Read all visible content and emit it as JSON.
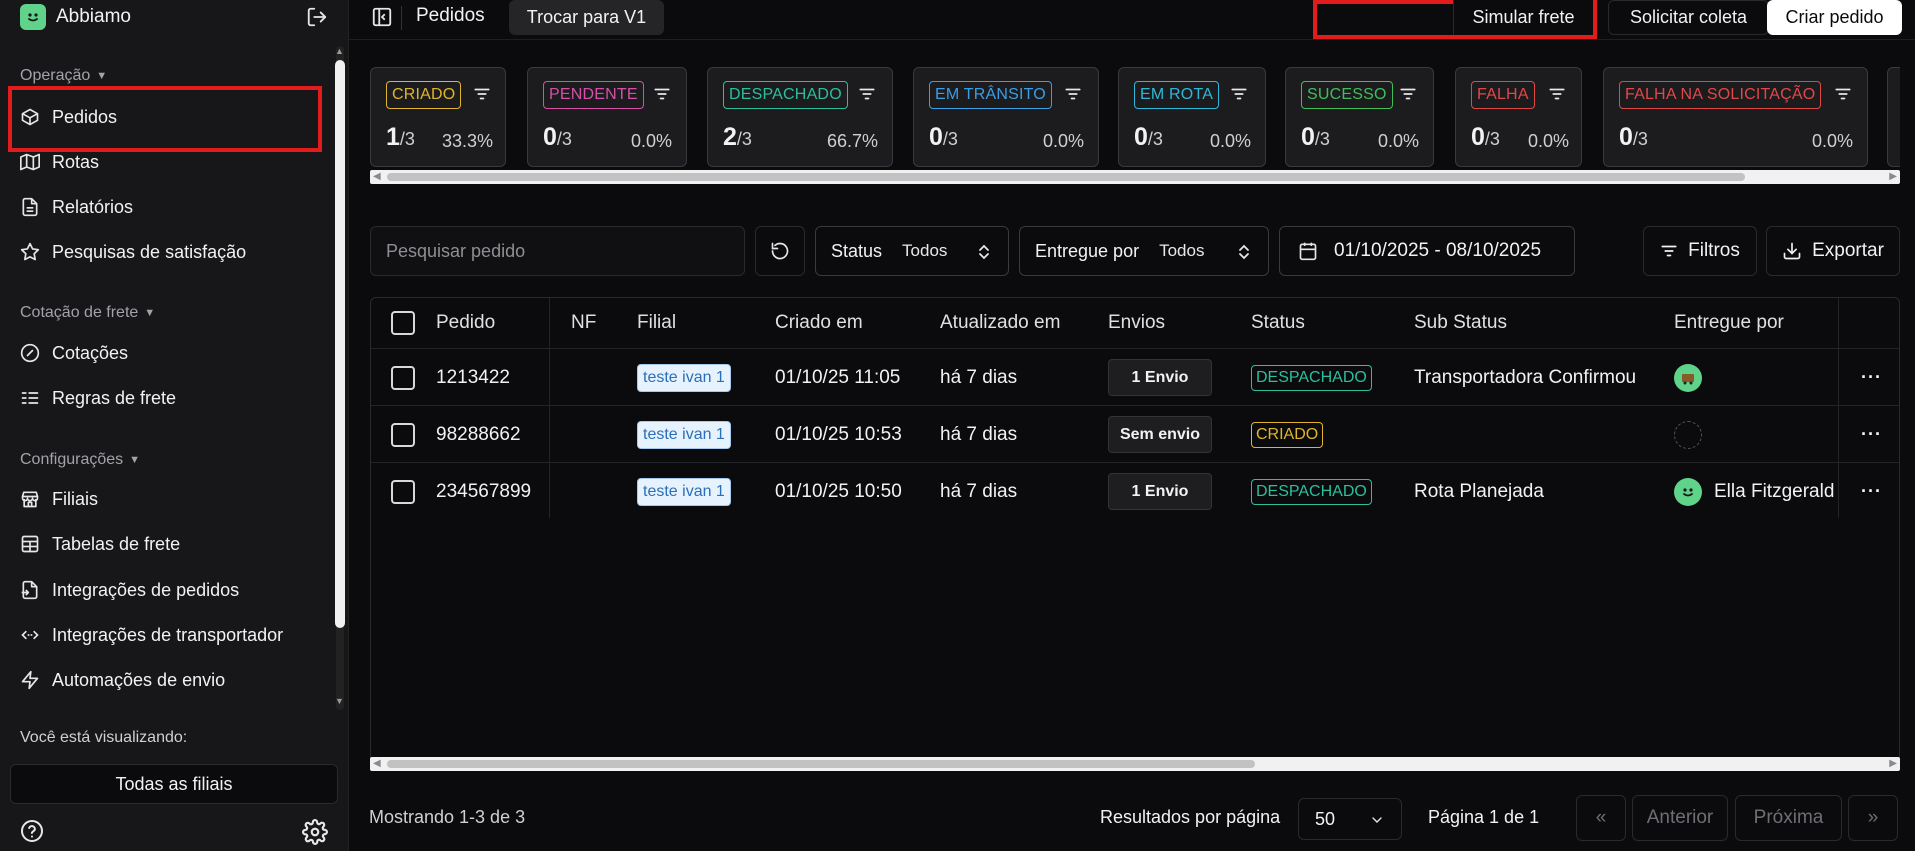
{
  "app": {
    "name": "Abbiamo"
  },
  "sidebar": {
    "sections": [
      {
        "title": "Operação",
        "items": [
          {
            "label": "Pedidos",
            "icon": "box-icon"
          },
          {
            "label": "Rotas",
            "icon": "map-icon"
          },
          {
            "label": "Relatórios",
            "icon": "file-text-icon"
          },
          {
            "label": "Pesquisas de satisfação",
            "icon": "star-icon"
          }
        ]
      },
      {
        "title": "Cotação de frete",
        "items": [
          {
            "label": "Cotações",
            "icon": "gauge-icon"
          },
          {
            "label": "Regras de frete",
            "icon": "list-rules-icon"
          }
        ]
      },
      {
        "title": "Configurações",
        "items": [
          {
            "label": "Filiais",
            "icon": "store-icon"
          },
          {
            "label": "Tabelas de frete",
            "icon": "table-icon"
          },
          {
            "label": "Integrações de pedidos",
            "icon": "file-import-icon"
          },
          {
            "label": "Integrações de transportador",
            "icon": "code-arrows-icon"
          },
          {
            "label": "Automações de envio",
            "icon": "zap-icon"
          }
        ]
      }
    ],
    "viewing_label": "Você está visualizando:",
    "branch_value": "Todas as filiais"
  },
  "topbar": {
    "title": "Pedidos",
    "switch_label": "Trocar para V1",
    "simulate_label": "Simular frete",
    "collect_label": "Solicitar coleta",
    "create_label": "Criar pedido"
  },
  "status_cards": [
    {
      "label": "CRIADO",
      "count": "1",
      "total": "/3",
      "pct": "33.3%",
      "color": "#e0b52c"
    },
    {
      "label": "PENDENTE",
      "count": "0",
      "total": "/3",
      "pct": "0.0%",
      "color": "#d74fa8"
    },
    {
      "label": "DESPACHADO",
      "count": "2",
      "total": "/3",
      "pct": "66.7%",
      "color": "#2bbfa0"
    },
    {
      "label": "EM TRÂNSITO",
      "count": "0",
      "total": "/3",
      "pct": "0.0%",
      "color": "#3a9ee6"
    },
    {
      "label": "EM ROTA",
      "count": "0",
      "total": "/3",
      "pct": "0.0%",
      "color": "#30b7d8"
    },
    {
      "label": "SUCESSO",
      "count": "0",
      "total": "/3",
      "pct": "0.0%",
      "color": "#3fbf5a"
    },
    {
      "label": "FALHA",
      "count": "0",
      "total": "/3",
      "pct": "0.0%",
      "color": "#e04848"
    },
    {
      "label": "FALHA NA SOLICITAÇÃO",
      "count": "0",
      "total": "/3",
      "pct": "0.0%",
      "color": "#e04848"
    }
  ],
  "filters": {
    "search_placeholder": "Pesquisar pedido",
    "status_label": "Status",
    "status_value": "Todos",
    "delivered_label": "Entregue por",
    "delivered_value": "Todos",
    "date_range": "01/10/2025 - 08/10/2025",
    "filters_label": "Filtros",
    "export_label": "Exportar"
  },
  "table": {
    "columns": [
      "Pedido",
      "NF",
      "Filial",
      "Criado em",
      "Atualizado em",
      "Envios",
      "Status",
      "Sub Status",
      "Entregue por"
    ],
    "rows": [
      {
        "pedido": "1213422",
        "nf": "",
        "filial": "teste ivan 1",
        "criado": "01/10/25 11:05",
        "atualizado": "há 7 dias",
        "envios": "1 Envio",
        "status": "DESPACHADO",
        "status_color": "#2bbfa0",
        "sub_status": "Transportadora Confirmou",
        "entregue": ""
      },
      {
        "pedido": "98288662",
        "nf": "",
        "filial": "teste ivan 1",
        "criado": "01/10/25 10:53",
        "atualizado": "há 7 dias",
        "envios": "Sem envio",
        "status": "CRIADO",
        "status_color": "#e0b52c",
        "sub_status": "",
        "entregue": ""
      },
      {
        "pedido": "234567899",
        "nf": "",
        "filial": "teste ivan 1",
        "criado": "01/10/25 10:50",
        "atualizado": "há 7 dias",
        "envios": "1 Envio",
        "status": "DESPACHADO",
        "status_color": "#2bbfa0",
        "sub_status": "Rota Planejada",
        "entregue": "Ella Fitzgerald"
      }
    ]
  },
  "footer": {
    "showing": "Mostrando 1-3 de 3",
    "rpp_label": "Resultados por página",
    "rpp_value": "50",
    "page_info": "Página 1 de 1",
    "first": "«",
    "prev": "Anterior",
    "next": "Próxima",
    "last": "»"
  }
}
